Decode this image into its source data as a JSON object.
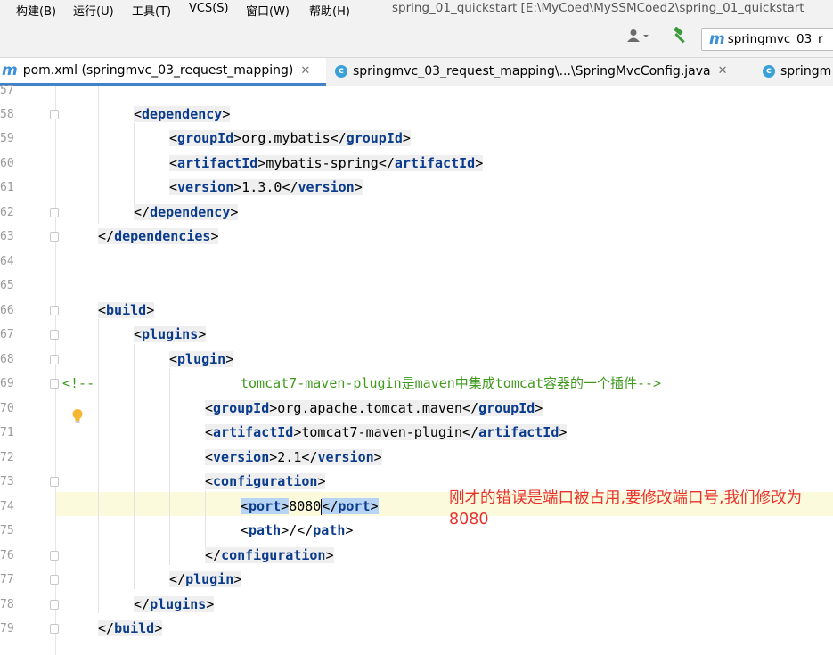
{
  "menubar": {
    "items": [
      "构建(B)",
      "运行(U)",
      "工具(T)",
      "VCS(S)",
      "窗口(W)",
      "帮助(H)"
    ],
    "window_title": "spring_01_quickstart [E:\\MyCoed\\MySSMCoed2\\spring_01_quickstart"
  },
  "toolbar": {
    "run_config_label": "springmvc_03_r",
    "icons": [
      "user-icon",
      "hammer-icon",
      "maven-icon"
    ]
  },
  "tabs": [
    {
      "label": "pom.xml (springmvc_03_request_mapping)",
      "icon": "maven-icon",
      "active": true
    },
    {
      "label": "springmvc_03_request_mapping\\...\\SpringMvcConfig.java",
      "icon": "class-icon",
      "active": false
    },
    {
      "label": "springm",
      "icon": "class-icon",
      "active": false
    }
  ],
  "editor": {
    "line_numbers": [
      "57",
      "58",
      "59",
      "60",
      "61",
      "62",
      "63",
      "64",
      "65",
      "66",
      "67",
      "68",
      "69",
      "70",
      "71",
      "72",
      "73",
      "74",
      "75",
      "76",
      "77",
      "78",
      "79"
    ],
    "lines": {
      "l58": {
        "tag": "dependency"
      },
      "l59": {
        "open": "groupId",
        "value": "org.mybatis",
        "close": "groupId"
      },
      "l60": {
        "open": "artifactId",
        "value": "mybatis-spring",
        "close": "artifactId"
      },
      "l61": {
        "open": "version",
        "value": "1.3.0",
        "close": "version"
      },
      "l62": {
        "tag": "dependency"
      },
      "l63": {
        "tag": "dependencies"
      },
      "l66": {
        "tag": "build"
      },
      "l67": {
        "tag": "plugins"
      },
      "l68": {
        "tag": "plugin"
      },
      "l69": {
        "comment_start": "<!--",
        "comment_text": "tomcat7-maven-plugin是maven中集成tomcat容器的一个插件-->"
      },
      "l70": {
        "open": "groupId",
        "value": "org.apache.tomcat.maven",
        "close": "groupId"
      },
      "l71": {
        "open": "artifactId",
        "value": "tomcat7-maven-plugin",
        "close": "artifactId"
      },
      "l72": {
        "open": "version",
        "value": "2.1",
        "close": "version"
      },
      "l73": {
        "tag": "configuration"
      },
      "l74": {
        "open": "port",
        "value": "8080",
        "close": "port"
      },
      "l75": {
        "open": "path",
        "value": "/",
        "close": "path"
      },
      "l76": {
        "tag": "configuration"
      },
      "l77": {
        "tag": "plugin"
      },
      "l78": {
        "tag": "plugins"
      },
      "l79": {
        "tag": "build"
      }
    },
    "annotation": "刚才的错误是端口被占用,要修改端口号,我们修改为8080"
  },
  "colors": {
    "tag": "#0b3b8c",
    "comment": "#3f9a1e",
    "annotation": "#e8322c",
    "selection": "#b8d4f5",
    "current_line": "#fcfadd"
  }
}
